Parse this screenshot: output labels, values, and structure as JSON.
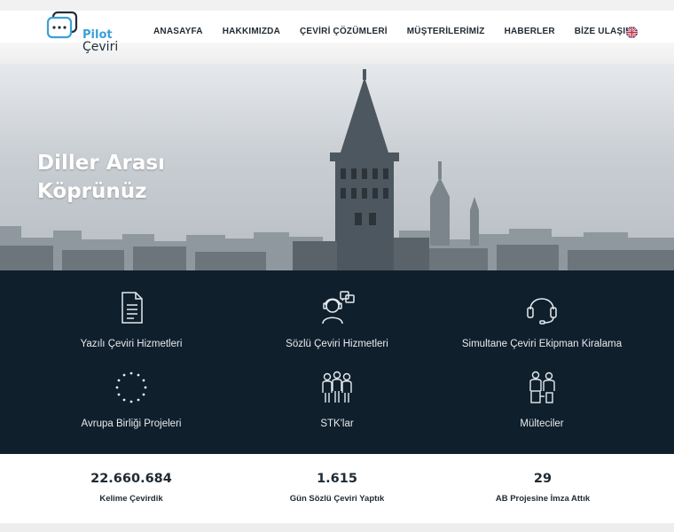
{
  "brand": {
    "logo_line1": "Pilot",
    "logo_line2": "Çeviri"
  },
  "nav": {
    "items": [
      {
        "label": "ANASAYFA"
      },
      {
        "label": "HAKKIMIZDA"
      },
      {
        "label": "ÇEVİRİ ÇÖZÜMLERİ"
      },
      {
        "label": "MÜŞTERİLERİMİZ"
      },
      {
        "label": "HABERLER"
      },
      {
        "label": "BİZE ULAŞIN"
      }
    ],
    "language_icon": "uk-flag-icon"
  },
  "hero": {
    "title_line1": "Diller Arası",
    "title_line2": "Köprünüz"
  },
  "services": [
    {
      "label": "Yazılı Çeviri Hizmetleri",
      "icon": "document-icon"
    },
    {
      "label": "Sözlü Çeviri Hizmetleri",
      "icon": "interpreter-icon"
    },
    {
      "label": "Simultane Çeviri Ekipman Kiralama",
      "icon": "headset-icon"
    },
    {
      "label": "Avrupa Birliği Projeleri",
      "icon": "eu-stars-icon"
    },
    {
      "label": "STK'lar",
      "icon": "group-icon"
    },
    {
      "label": "Mülteciler",
      "icon": "refugees-icon"
    }
  ],
  "stats": [
    {
      "value": "22.660.684",
      "label": "Kelime Çevirdik"
    },
    {
      "value": "1.615",
      "label": "Gün Sözlü Çeviri Yaptık"
    },
    {
      "value": "29",
      "label": "AB Projesine İmza Attık"
    }
  ],
  "colors": {
    "brand_blue": "#3aa0d8",
    "dark_navy": "#0f1f2c",
    "text_dark": "#1f2a33"
  }
}
